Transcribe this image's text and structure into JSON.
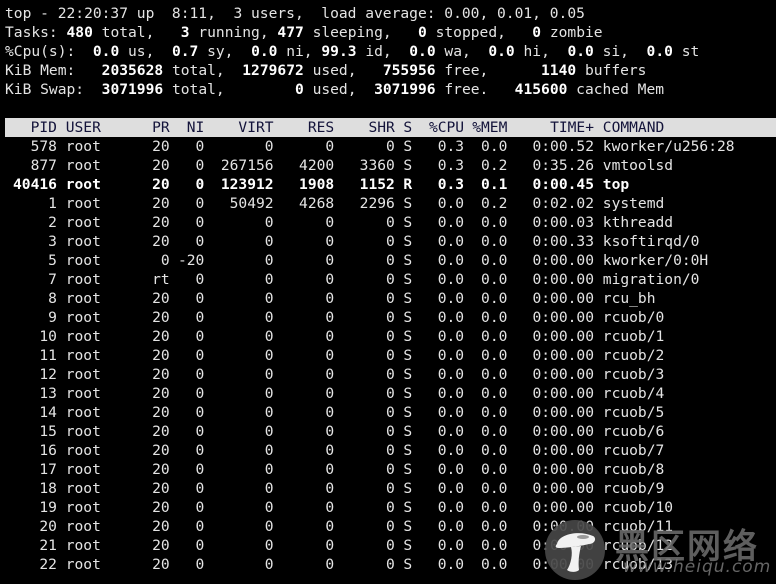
{
  "summary": {
    "line1": "top - 22:20:37 up  8:11,  3 users,  load average: 0.00, 0.01, 0.05",
    "tasks": {
      "label": "Tasks:",
      "total": "480",
      "total_label": " total,",
      "running": "3",
      "running_label": " running,",
      "sleeping": "477",
      "sleeping_label": " sleeping,",
      "stopped": "0",
      "stopped_label": " stopped,",
      "zombie": "0",
      "zombie_label": " zombie"
    },
    "cpu": {
      "label": "%Cpu(s):",
      "us": "0.0",
      "us_label": " us,",
      "sy": "0.7",
      "sy_label": " sy,",
      "ni": "0.0",
      "ni_label": " ni,",
      "id": "99.3",
      "id_label": " id,",
      "wa": "0.0",
      "wa_label": " wa,",
      "hi": "0.0",
      "hi_label": " hi,",
      "si": "0.0",
      "si_label": " si,",
      "st": "0.0",
      "st_label": " st"
    },
    "mem": {
      "label": "KiB Mem:",
      "total": "2035628",
      "total_label": " total,",
      "used": "1279672",
      "used_label": " used,",
      "free": "755956",
      "free_label": " free,",
      "buffers": "1140",
      "buffers_label": " buffers"
    },
    "swap": {
      "label": "KiB Swap:",
      "total": "3071996",
      "total_label": " total,",
      "used": "0",
      "used_label": " used,",
      "free": "3071996",
      "free_label": " free.",
      "cached": "415600",
      "cached_label": " cached Mem"
    }
  },
  "table": {
    "headers": {
      "pid": "PID",
      "user": "USER",
      "pr": "PR",
      "ni": "NI",
      "virt": "VIRT",
      "res": "RES",
      "shr": "SHR",
      "s": "S",
      "cpu": "%CPU",
      "mem": "%MEM",
      "time": "TIME+",
      "command": "COMMAND"
    },
    "rows": [
      {
        "pid": "578",
        "user": "root",
        "pr": "20",
        "ni": "0",
        "virt": "0",
        "res": "0",
        "shr": "0",
        "s": "S",
        "cpu": "0.3",
        "mem": "0.0",
        "time": "0:00.52",
        "command": "kworker/u256:28"
      },
      {
        "pid": "877",
        "user": "root",
        "pr": "20",
        "ni": "0",
        "virt": "267156",
        "res": "4200",
        "shr": "3360",
        "s": "S",
        "cpu": "0.3",
        "mem": "0.2",
        "time": "0:35.26",
        "command": "vmtoolsd"
      },
      {
        "pid": "40416",
        "user": "root",
        "pr": "20",
        "ni": "0",
        "virt": "123912",
        "res": "1908",
        "shr": "1152",
        "s": "R",
        "cpu": "0.3",
        "mem": "0.1",
        "time": "0:00.45",
        "command": "top",
        "highlighted": true
      },
      {
        "pid": "1",
        "user": "root",
        "pr": "20",
        "ni": "0",
        "virt": "50492",
        "res": "4268",
        "shr": "2296",
        "s": "S",
        "cpu": "0.0",
        "mem": "0.2",
        "time": "0:02.02",
        "command": "systemd"
      },
      {
        "pid": "2",
        "user": "root",
        "pr": "20",
        "ni": "0",
        "virt": "0",
        "res": "0",
        "shr": "0",
        "s": "S",
        "cpu": "0.0",
        "mem": "0.0",
        "time": "0:00.03",
        "command": "kthreadd"
      },
      {
        "pid": "3",
        "user": "root",
        "pr": "20",
        "ni": "0",
        "virt": "0",
        "res": "0",
        "shr": "0",
        "s": "S",
        "cpu": "0.0",
        "mem": "0.0",
        "time": "0:00.33",
        "command": "ksoftirqd/0"
      },
      {
        "pid": "5",
        "user": "root",
        "pr": "0",
        "ni": "-20",
        "virt": "0",
        "res": "0",
        "shr": "0",
        "s": "S",
        "cpu": "0.0",
        "mem": "0.0",
        "time": "0:00.00",
        "command": "kworker/0:0H"
      },
      {
        "pid": "7",
        "user": "root",
        "pr": "rt",
        "ni": "0",
        "virt": "0",
        "res": "0",
        "shr": "0",
        "s": "S",
        "cpu": "0.0",
        "mem": "0.0",
        "time": "0:00.00",
        "command": "migration/0"
      },
      {
        "pid": "8",
        "user": "root",
        "pr": "20",
        "ni": "0",
        "virt": "0",
        "res": "0",
        "shr": "0",
        "s": "S",
        "cpu": "0.0",
        "mem": "0.0",
        "time": "0:00.00",
        "command": "rcu_bh"
      },
      {
        "pid": "9",
        "user": "root",
        "pr": "20",
        "ni": "0",
        "virt": "0",
        "res": "0",
        "shr": "0",
        "s": "S",
        "cpu": "0.0",
        "mem": "0.0",
        "time": "0:00.00",
        "command": "rcuob/0"
      },
      {
        "pid": "10",
        "user": "root",
        "pr": "20",
        "ni": "0",
        "virt": "0",
        "res": "0",
        "shr": "0",
        "s": "S",
        "cpu": "0.0",
        "mem": "0.0",
        "time": "0:00.00",
        "command": "rcuob/1"
      },
      {
        "pid": "11",
        "user": "root",
        "pr": "20",
        "ni": "0",
        "virt": "0",
        "res": "0",
        "shr": "0",
        "s": "S",
        "cpu": "0.0",
        "mem": "0.0",
        "time": "0:00.00",
        "command": "rcuob/2"
      },
      {
        "pid": "12",
        "user": "root",
        "pr": "20",
        "ni": "0",
        "virt": "0",
        "res": "0",
        "shr": "0",
        "s": "S",
        "cpu": "0.0",
        "mem": "0.0",
        "time": "0:00.00",
        "command": "rcuob/3"
      },
      {
        "pid": "13",
        "user": "root",
        "pr": "20",
        "ni": "0",
        "virt": "0",
        "res": "0",
        "shr": "0",
        "s": "S",
        "cpu": "0.0",
        "mem": "0.0",
        "time": "0:00.00",
        "command": "rcuob/4"
      },
      {
        "pid": "14",
        "user": "root",
        "pr": "20",
        "ni": "0",
        "virt": "0",
        "res": "0",
        "shr": "0",
        "s": "S",
        "cpu": "0.0",
        "mem": "0.0",
        "time": "0:00.00",
        "command": "rcuob/5"
      },
      {
        "pid": "15",
        "user": "root",
        "pr": "20",
        "ni": "0",
        "virt": "0",
        "res": "0",
        "shr": "0",
        "s": "S",
        "cpu": "0.0",
        "mem": "0.0",
        "time": "0:00.00",
        "command": "rcuob/6"
      },
      {
        "pid": "16",
        "user": "root",
        "pr": "20",
        "ni": "0",
        "virt": "0",
        "res": "0",
        "shr": "0",
        "s": "S",
        "cpu": "0.0",
        "mem": "0.0",
        "time": "0:00.00",
        "command": "rcuob/7"
      },
      {
        "pid": "17",
        "user": "root",
        "pr": "20",
        "ni": "0",
        "virt": "0",
        "res": "0",
        "shr": "0",
        "s": "S",
        "cpu": "0.0",
        "mem": "0.0",
        "time": "0:00.00",
        "command": "rcuob/8"
      },
      {
        "pid": "18",
        "user": "root",
        "pr": "20",
        "ni": "0",
        "virt": "0",
        "res": "0",
        "shr": "0",
        "s": "S",
        "cpu": "0.0",
        "mem": "0.0",
        "time": "0:00.00",
        "command": "rcuob/9"
      },
      {
        "pid": "19",
        "user": "root",
        "pr": "20",
        "ni": "0",
        "virt": "0",
        "res": "0",
        "shr": "0",
        "s": "S",
        "cpu": "0.0",
        "mem": "0.0",
        "time": "0:00.00",
        "command": "rcuob/10"
      },
      {
        "pid": "20",
        "user": "root",
        "pr": "20",
        "ni": "0",
        "virt": "0",
        "res": "0",
        "shr": "0",
        "s": "S",
        "cpu": "0.0",
        "mem": "0.0",
        "time": "0:00.00",
        "command": "rcuob/11"
      },
      {
        "pid": "21",
        "user": "root",
        "pr": "20",
        "ni": "0",
        "virt": "0",
        "res": "0",
        "shr": "0",
        "s": "S",
        "cpu": "0.0",
        "mem": "0.0",
        "time": "0:00.00",
        "command": "rcuob/12"
      },
      {
        "pid": "22",
        "user": "root",
        "pr": "20",
        "ni": "0",
        "virt": "0",
        "res": "0",
        "shr": "0",
        "s": "S",
        "cpu": "0.0",
        "mem": "0.0",
        "time": "0:00.00",
        "command": "rcuob/13"
      }
    ]
  },
  "watermark": {
    "logo_icon": "mushroom-logo-icon",
    "text": "黑区网络",
    "url": "www.heiqu.com"
  },
  "colors": {
    "background": "#000000",
    "text": "#e4e4e4",
    "header_bar_bg": "#dedede",
    "header_bar_text": "#13133a"
  }
}
